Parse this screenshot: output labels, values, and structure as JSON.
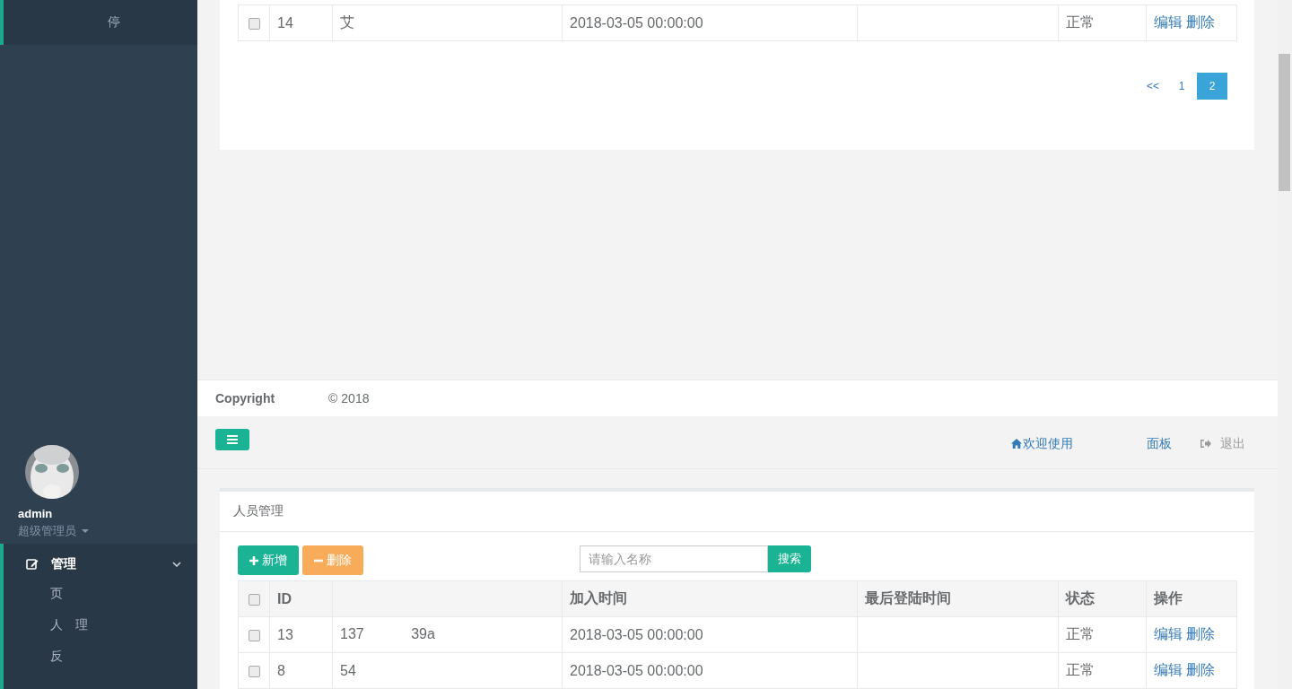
{
  "sidebar": {
    "top_item": {
      "label": "停",
      "selected": true
    },
    "profile": {
      "name": "admin",
      "role": "超级管理员"
    },
    "menu": {
      "label": "管理",
      "expanded": true,
      "children": [
        {
          "label": "页"
        },
        {
          "label": "人　理"
        },
        {
          "label": "反"
        }
      ]
    }
  },
  "upper_table": {
    "rows": [
      {
        "checked": false,
        "id": "14",
        "column_3": "艾",
        "join_time": "2018-03-05 00:00:00",
        "status": "正常",
        "actions": [
          "编辑",
          "删除"
        ]
      }
    ]
  },
  "pagination": [
    {
      "label": "<<",
      "selected": false
    },
    {
      "label": "1",
      "selected": false
    },
    {
      "label": "2",
      "selected": true
    }
  ],
  "footer": {
    "copyright": "Copyright",
    "year": "© 2018"
  },
  "header": {
    "welcome": "欢迎使用",
    "welcome_end": "面板",
    "logout": "退出"
  },
  "panel": {
    "title": "人员管理",
    "buttons": [
      {
        "kind": "add",
        "label": "新增"
      },
      {
        "kind": "delete",
        "label": "删除"
      }
    ],
    "search": {
      "placeholder": "请输入名称",
      "button": "搜索"
    },
    "header_checked": false,
    "columns": [
      {
        "kind": "text",
        "label": "ID"
      },
      {
        "kind": "blurred"
      },
      {
        "kind": "text",
        "label": "加入时间"
      },
      {
        "kind": "text",
        "label": "最后登陆时间"
      },
      {
        "kind": "text",
        "label": "状态"
      },
      {
        "kind": "text",
        "label": "操作"
      }
    ],
    "rows": [
      {
        "checked": false,
        "id": "13",
        "column_3": "137　　　 39a",
        "join_time": "2018-03-05 00:00:00",
        "status": "正常",
        "actions": [
          "编辑",
          "删除"
        ]
      },
      {
        "checked": false,
        "id": "8",
        "column_3": "54",
        "join_time": "2018-03-05 00:00:00",
        "status": "正常",
        "actions": [
          "编辑",
          "删除"
        ]
      }
    ]
  }
}
